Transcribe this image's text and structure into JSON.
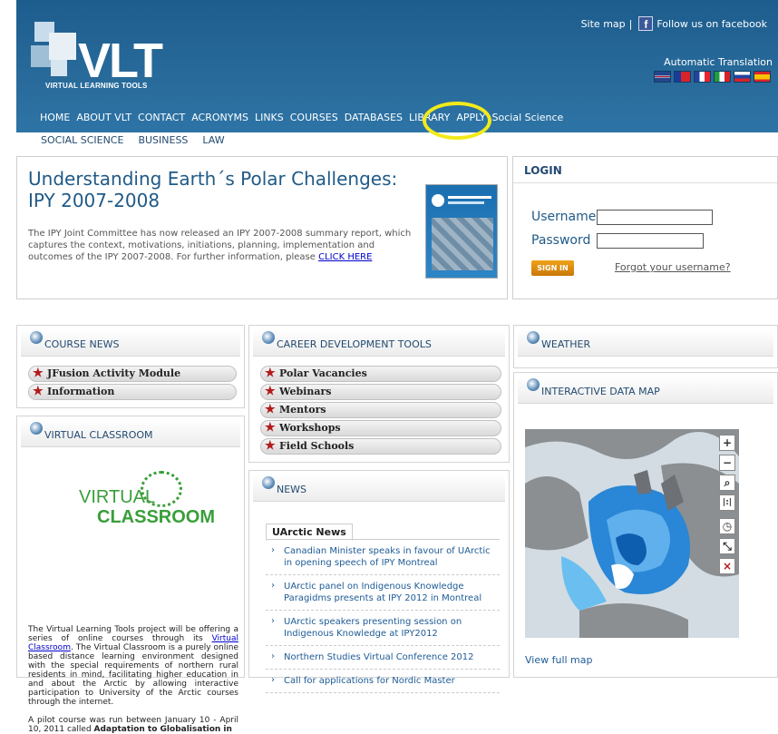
{
  "header": {
    "brand": "VLT",
    "brand_sub": "VIRTUAL LEARNING TOOLS",
    "sitemap": "Site map",
    "separator": "|",
    "facebook": "Follow us on facebook",
    "auto_translation": "Automatic Translation",
    "flags": [
      {
        "name": "english-flag-icon",
        "color": "#24458a"
      },
      {
        "name": "taiwan-flag-icon",
        "color": "#d8232a"
      },
      {
        "name": "french-flag-icon",
        "color": "#2243a0"
      },
      {
        "name": "italian-flag-icon",
        "color": "#1e9c3e"
      },
      {
        "name": "russian-flag-icon",
        "color": "#ffffff"
      },
      {
        "name": "spanish-flag-icon",
        "color": "#d8232a"
      }
    ],
    "nav": [
      "HOME",
      "ABOUT VLT",
      "CONTACT",
      "ACRONYMS",
      "LINKS",
      "COURSES",
      "DATABASES",
      "LIBRARY",
      "APPLY",
      "Social Science"
    ],
    "subnav": [
      "SOCIAL SCIENCE",
      "BUSINESS",
      "LAW"
    ]
  },
  "polar": {
    "title": "Understanding Earth´s Polar Challenges: IPY 2007-2008",
    "body": "The IPY Joint Committee has now released an IPY 2007-2008 summary report, which  captures the context, motivations, initiations, planning, implementation and outcomes of the IPY 2007-2008. For further information, please ",
    "link": "CLICK HERE"
  },
  "login": {
    "title": "LOGIN",
    "username_label": "Username",
    "password_label": "Password",
    "sign_in": "SIGN IN",
    "forgot": "Forgot your username?"
  },
  "course_news": {
    "title": "COURSE NEWS",
    "items": [
      "JFusion Activity Module",
      "Information"
    ]
  },
  "career": {
    "title": "CAREER DEVELOPMENT TOOLS",
    "items": [
      "Polar Vacancies",
      "Webinars",
      "Mentors",
      "Workshops",
      "Field Schools"
    ]
  },
  "weather": {
    "title": "WEATHER"
  },
  "virtual_classroom": {
    "title": "VIRTUAL CLASSROOM",
    "logo_line1": "VIRTUAL",
    "logo_line2": "CLASSROOM",
    "text1": "The Virtual Learning Tools project will be offering a series of online courses through its ",
    "text1_link": "Virtual Classroom",
    "text1_rest": ". The Virtual Classroom is a purely online based distance learning environment designed with the special requirements of northern rural residents in mind, facilitating higher education in and about the Arctic by allowing interactive participation to University of the Arctic courses through the internet.",
    "text2": "A pilot course was run between January 10 - April 10, 2011 called ",
    "text2_bold": "Adaptation to Globalisation in"
  },
  "news": {
    "title": "NEWS",
    "tab": "UArctic News",
    "items": [
      "Canadian Minister speaks in favour of UArctic in opening speech of IPY Montreal",
      "UArctic panel on Indigenous Knowledge Paragidms presents at IPY 2012 in Montreal",
      "UArctic speakers presenting session on Indigenous Knowledge at IPY2012",
      "Northern Studies Virtual Conference 2012",
      "Call for applications for Nordic Master"
    ]
  },
  "datamap": {
    "title": "INTERACTIVE DATA MAP",
    "view_full": "View full map",
    "controls": [
      "+",
      "−",
      "🔍",
      "|:|",
      "◷",
      "⤡",
      "×"
    ]
  }
}
